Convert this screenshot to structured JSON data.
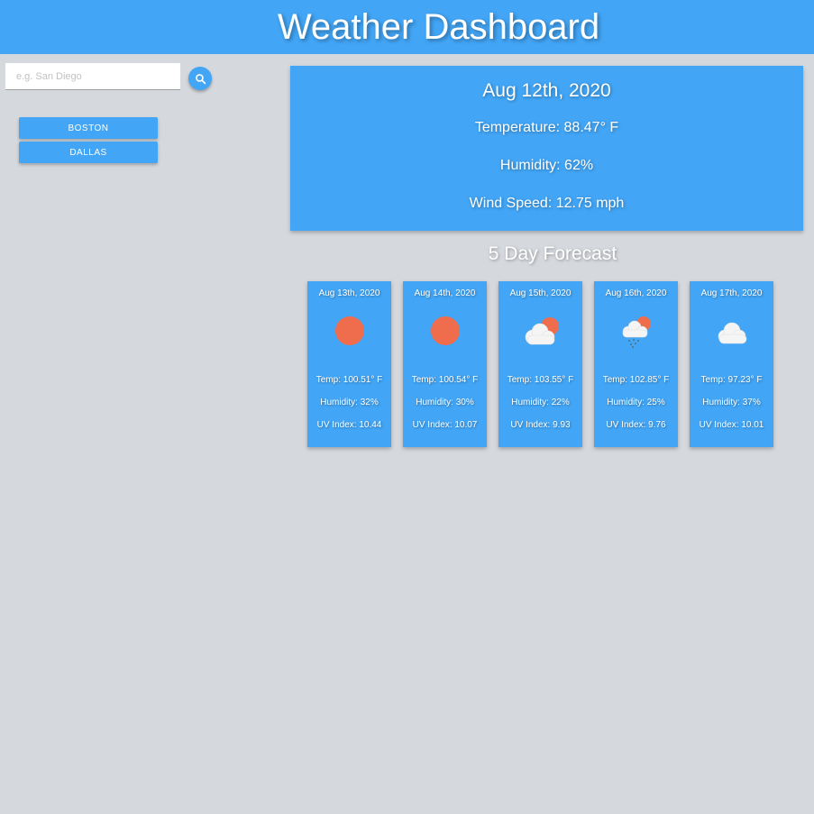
{
  "header": {
    "title": "Weather Dashboard"
  },
  "search": {
    "placeholder": "e.g. San Diego",
    "value": ""
  },
  "history": [
    {
      "label": "BOSTON"
    },
    {
      "label": "DALLAS"
    }
  ],
  "current": {
    "date": "Aug 12th, 2020",
    "temperature": "Temperature: 88.47° F",
    "humidity": "Humidity: 62%",
    "wind": "Wind Speed: 12.75 mph"
  },
  "forecast": {
    "title": "5 Day Forecast",
    "days": [
      {
        "date": "Aug 13th, 2020",
        "icon": "sun-icon",
        "temp": "Temp: 100.51° F",
        "humidity": "Humidity: 32%",
        "uv": "UV Index: 10.44"
      },
      {
        "date": "Aug 14th, 2020",
        "icon": "sun-icon",
        "temp": "Temp: 100.54° F",
        "humidity": "Humidity: 30%",
        "uv": "UV Index: 10.07"
      },
      {
        "date": "Aug 15th, 2020",
        "icon": "partly-cloudy-icon",
        "temp": "Temp: 103.55° F",
        "humidity": "Humidity: 22%",
        "uv": "UV Index: 9.93"
      },
      {
        "date": "Aug 16th, 2020",
        "icon": "rain-cloud-sun-icon",
        "temp": "Temp: 102.85° F",
        "humidity": "Humidity: 25%",
        "uv": "UV Index: 9.76"
      },
      {
        "date": "Aug 17th, 2020",
        "icon": "cloud-icon",
        "temp": "Temp: 97.23° F",
        "humidity": "Humidity: 37%",
        "uv": "UV Index: 10.01"
      }
    ]
  },
  "colors": {
    "accent": "#42a5f5",
    "background": "#d5d8dd",
    "sun": "#ef6c4c",
    "cloud": "#f5f5f5"
  }
}
